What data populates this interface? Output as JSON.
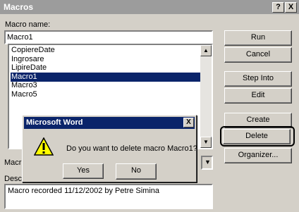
{
  "window": {
    "title": "Macros",
    "help_btn": "?",
    "close_btn": "X"
  },
  "macro_name": {
    "label": "Macro name:",
    "value": "Macro1"
  },
  "macro_list": {
    "items": [
      "CopiereDate",
      "Ingrosare",
      "LipireDate",
      "Macro1",
      "Macro3",
      "Macro5"
    ],
    "selected_index": 3
  },
  "buttons": {
    "run": "Run",
    "cancel": "Cancel",
    "step_into": "Step Into",
    "edit": "Edit",
    "create": "Create",
    "delete": "Delete",
    "organizer": "Organizer..."
  },
  "macros_in": {
    "label_partial": "Macro"
  },
  "description": {
    "label_partial": "Descr",
    "value": "Macro recorded 11/12/2002 by Petre Simina"
  },
  "confirm_dialog": {
    "title": "Microsoft Word",
    "close_btn": "X",
    "icon": "warning-icon",
    "message": "Do you want to delete macro Macro1?",
    "yes": "Yes",
    "no": "No"
  },
  "colors": {
    "selection": "#0a246a",
    "inactive_title": "#9c9c9c",
    "face": "#d4d0c8"
  }
}
